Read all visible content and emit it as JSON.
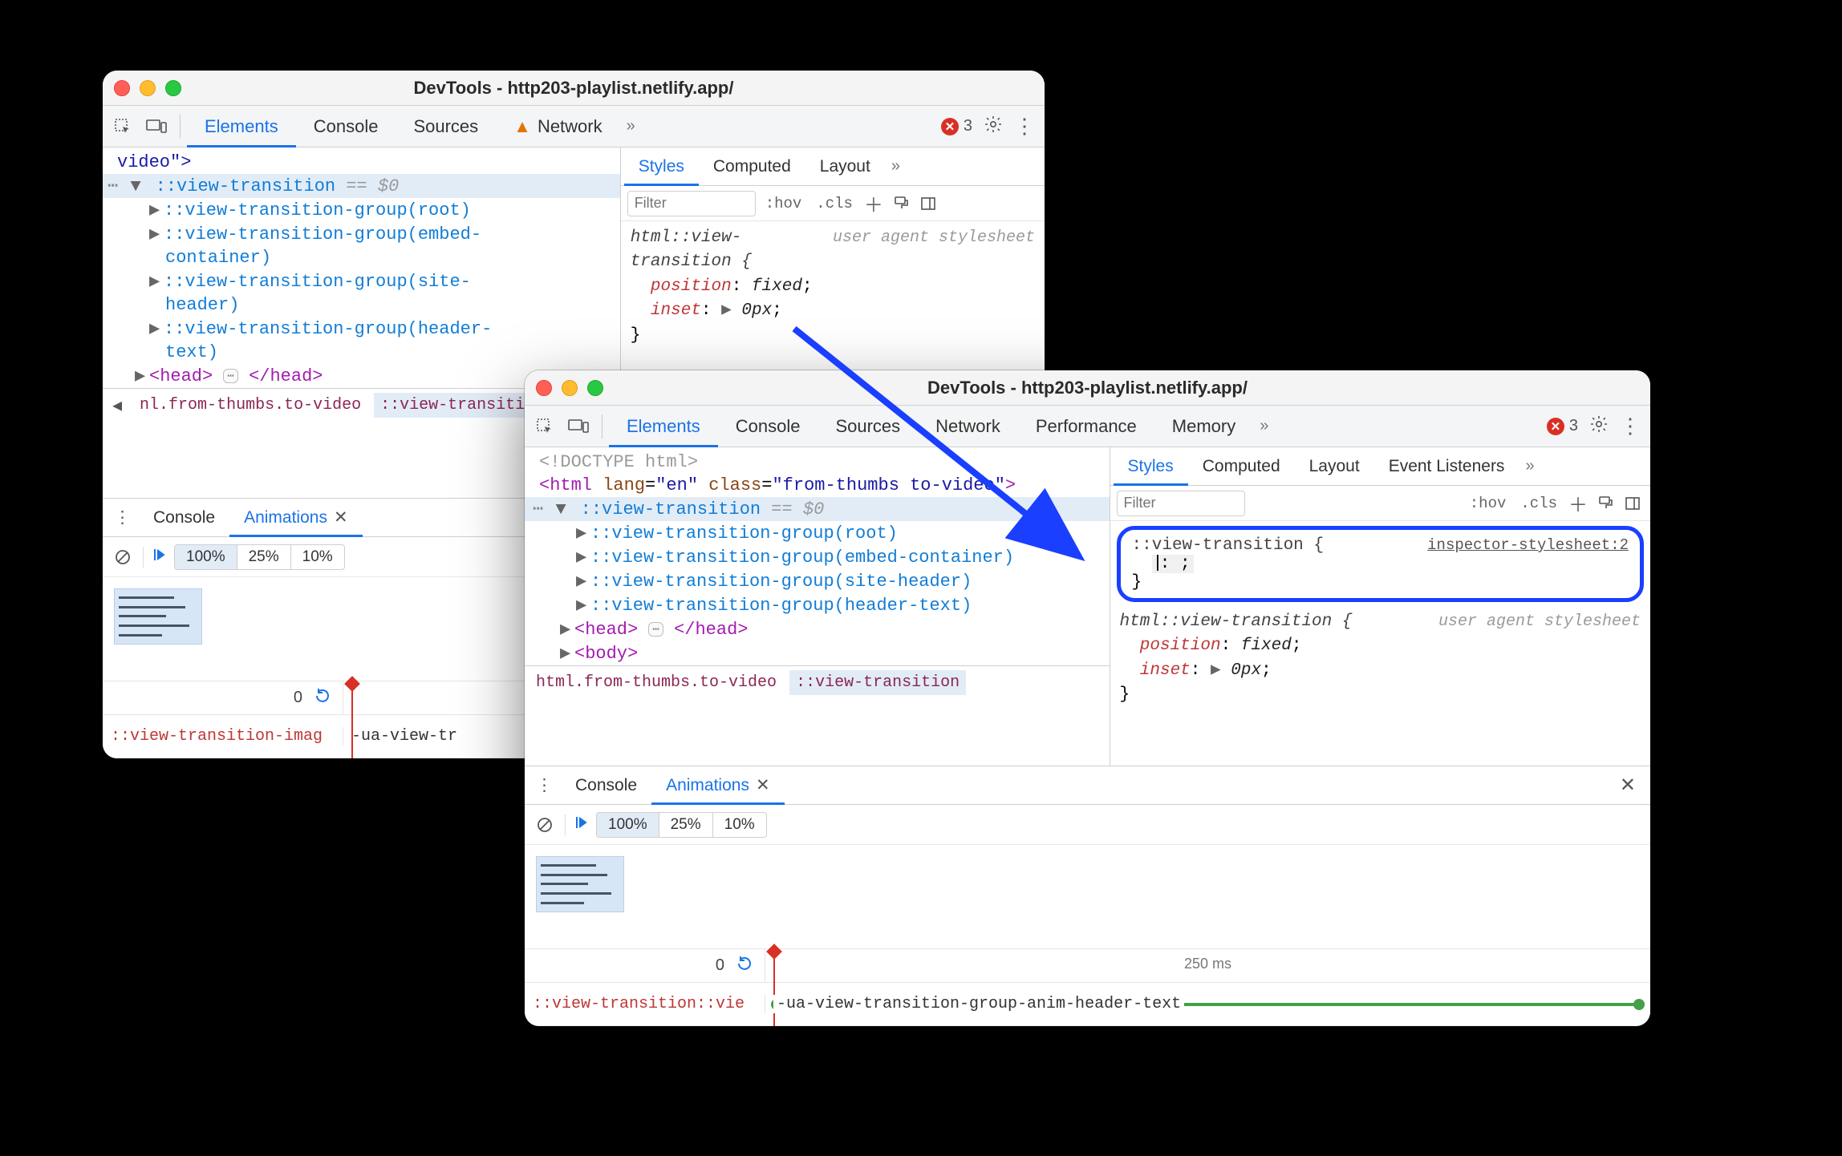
{
  "winA": {
    "title": "DevTools - http203-playlist.netlify.app/",
    "tabs": [
      "Elements",
      "Console",
      "Sources",
      "Network"
    ],
    "activeTab": "Elements",
    "errCount": "3",
    "tree": {
      "line0": "video\">",
      "sel": "::view-transition",
      "selSuffix": " == $0",
      "g0": "::view-transition-group(root)",
      "g1a": "::view-transition-group(embed-",
      "g1b": "container)",
      "g2a": "::view-transition-group(site-",
      "g2b": "header)",
      "g3a": "::view-transition-group(header-",
      "g3b": "text)",
      "head_open": "<head>",
      "head_close": "</head>"
    },
    "crumbs": {
      "left": "nl.from-thumbs.to-video",
      "right": "::view-transition"
    },
    "stylesTabs": [
      "Styles",
      "Computed",
      "Layout"
    ],
    "filterPlaceholder": "Filter",
    "toggles": [
      ":hov",
      ".cls"
    ],
    "css": {
      "selector": "html::view-transition {",
      "ua": "user agent stylesheet",
      "p1": "position",
      "v1": "fixed",
      "p2": "inset",
      "v2": "0px",
      "close": "}"
    },
    "drawerTabs": {
      "console": "Console",
      "anim": "Animations"
    },
    "speeds": [
      "100%",
      "25%",
      "10%"
    ],
    "timelineZero": "0",
    "animLabel": "::view-transition-imag",
    "animName": "-ua-view-tr"
  },
  "winB": {
    "title": "DevTools - http203-playlist.netlify.app/",
    "tabs": [
      "Elements",
      "Console",
      "Sources",
      "Network",
      "Performance",
      "Memory"
    ],
    "activeTab": "Elements",
    "errCount": "3",
    "tree": {
      "doctype": "<!DOCTYPE html>",
      "html_open": "<html ",
      "lang_attr": "lang",
      "lang_val": "\"en\"",
      "class_attr": "class",
      "class_val": "\"from-thumbs to-video\"",
      "html_open_end": ">",
      "sel": "::view-transition",
      "selSuffix": " == $0",
      "g0": "::view-transition-group(root)",
      "g1": "::view-transition-group(embed-container)",
      "g2": "::view-transition-group(site-header)",
      "g3": "::view-transition-group(header-text)",
      "head_open": "<head>",
      "head_close": "</head>",
      "body_open": "<body>"
    },
    "crumbs": {
      "left": "html.from-thumbs.to-video",
      "right": "::view-transition"
    },
    "stylesTabs": [
      "Styles",
      "Computed",
      "Layout",
      "Event Listeners"
    ],
    "filterPlaceholder": "Filter",
    "toggles": [
      ":hov",
      ".cls"
    ],
    "highlight": {
      "selector": "::view-transition {",
      "source": "inspector-stylesheet:2",
      "edit": ":  ;",
      "close": "}"
    },
    "css": {
      "selector": "html::view-transition {",
      "ua": "user agent stylesheet",
      "p1": "position",
      "v1": "fixed",
      "p2": "inset",
      "v2": "0px",
      "close": "}"
    },
    "drawerTabs": {
      "console": "Console",
      "anim": "Animations"
    },
    "speeds": [
      "100%",
      "25%",
      "10%"
    ],
    "timelineZero": "0",
    "timelineTick": "250 ms",
    "animLabel": "::view-transition::vie",
    "animName": "-ua-view-transition-group-anim-header-text"
  }
}
